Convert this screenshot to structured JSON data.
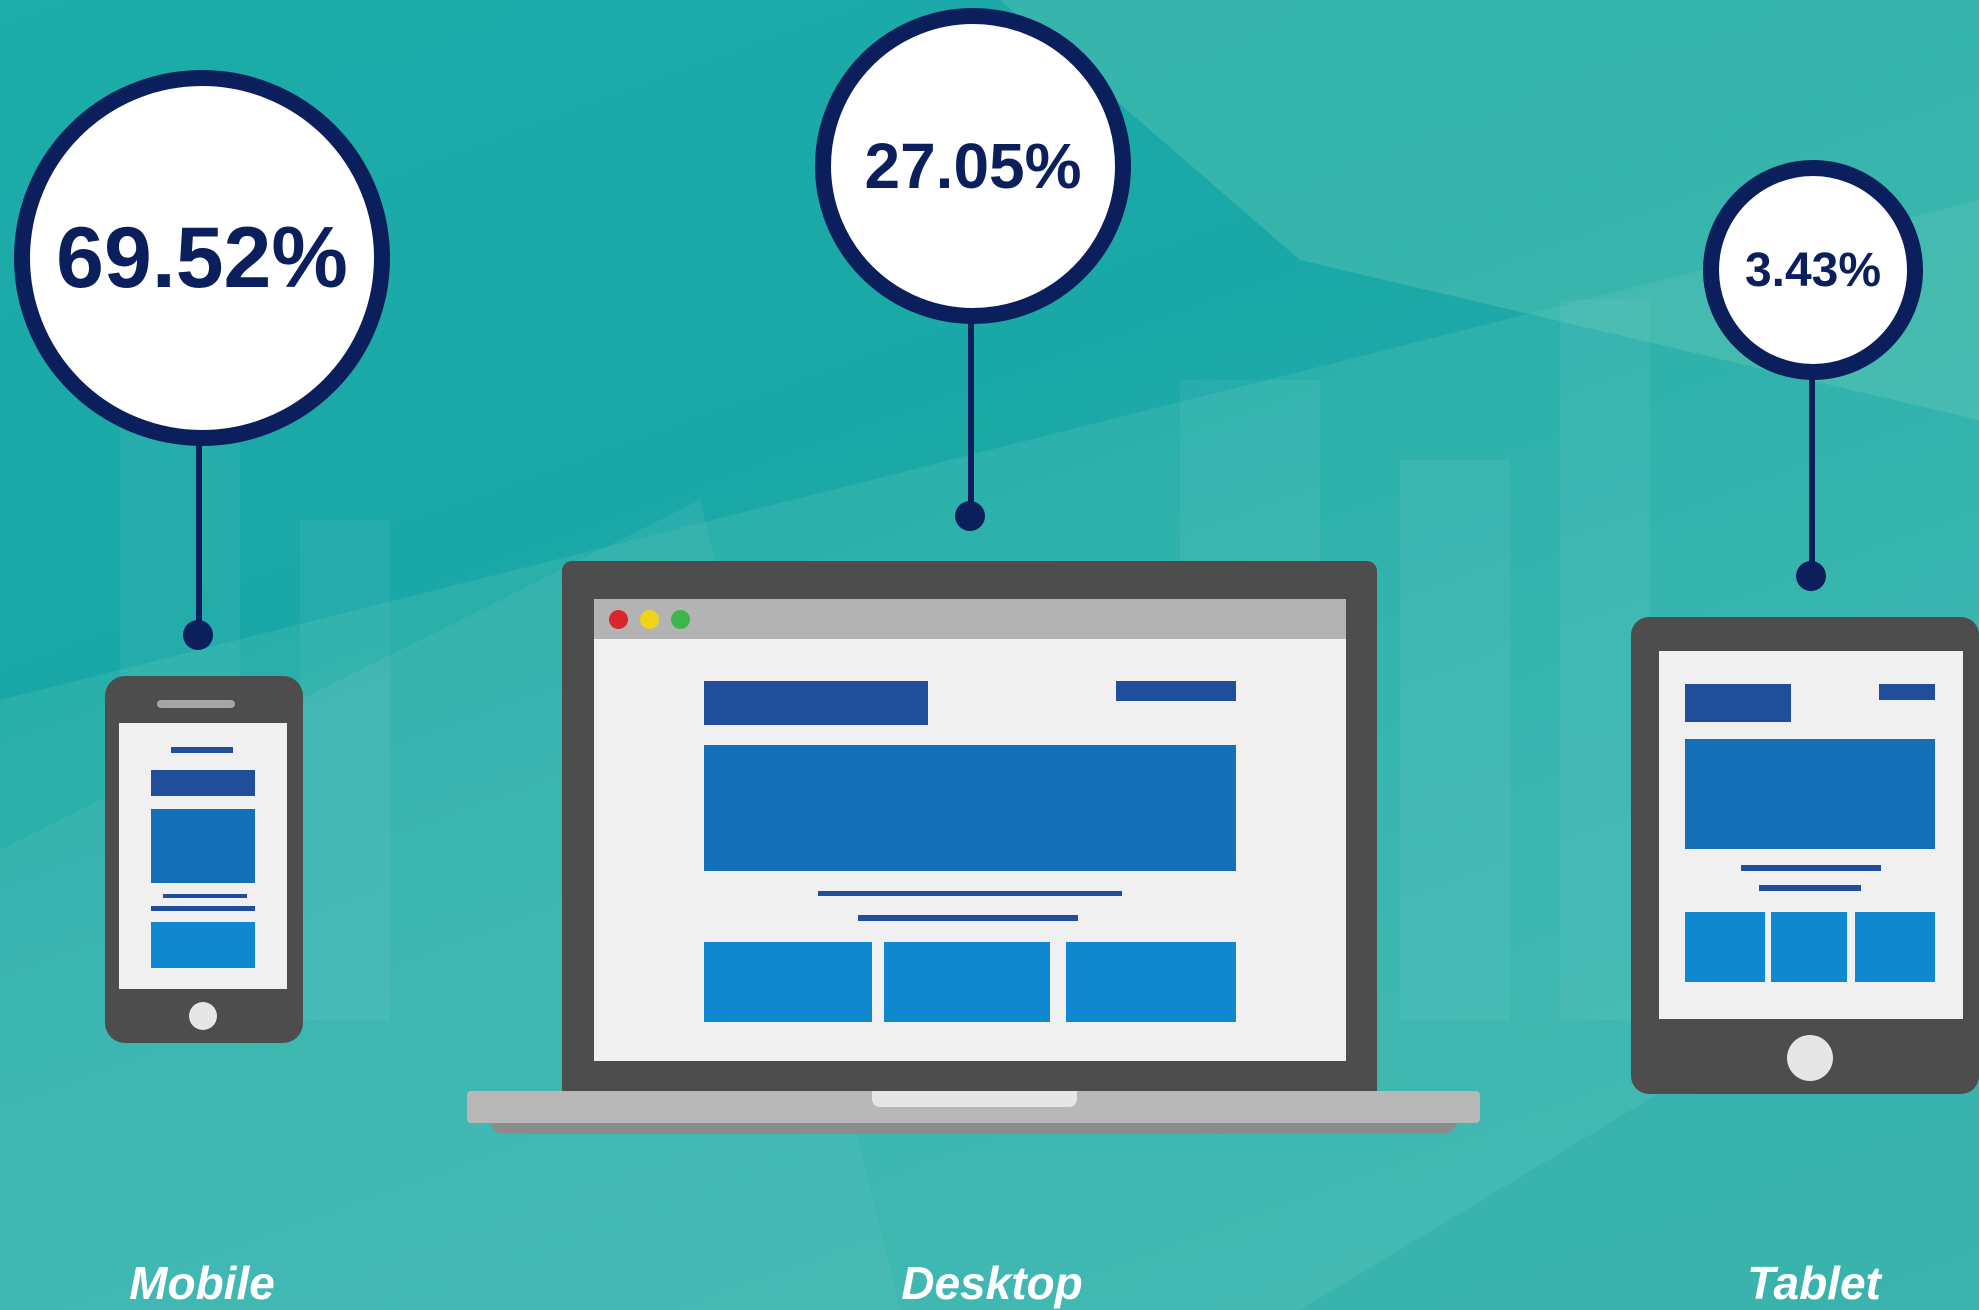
{
  "devices": [
    {
      "name": "Mobile",
      "share": "69.52%"
    },
    {
      "name": "Desktop",
      "share": "27.05%"
    },
    {
      "name": "Tablet",
      "share": "3.43%"
    }
  ],
  "colors": {
    "background": "#22b3ad",
    "navy": "#0a1f5c",
    "device_body": "#4d4d4d",
    "screen": "#f0f0f0",
    "block_dark": "#214e9b",
    "block_mid": "#1670b8",
    "block_light": "#0f88d0",
    "window_red": "#d9262b",
    "window_yellow": "#f2d318",
    "window_green": "#3db54a"
  }
}
